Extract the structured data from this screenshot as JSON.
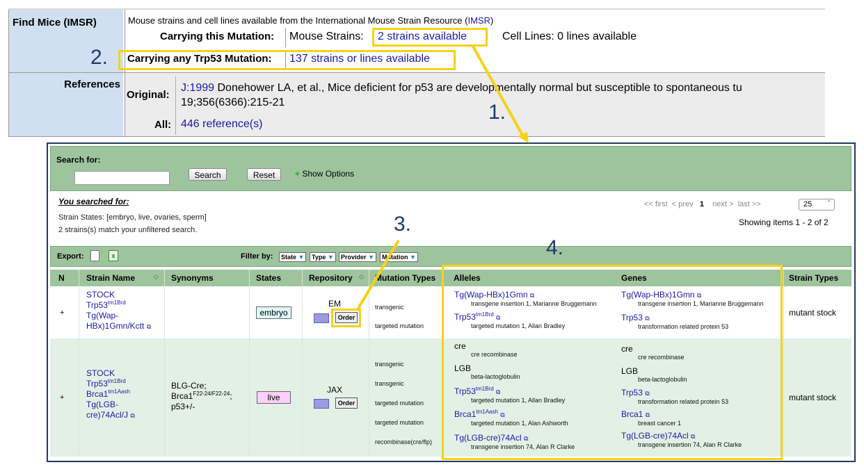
{
  "top": {
    "find_mice_label": "Find Mice (IMSR)",
    "imsr_text": "Mouse strains and cell lines available from the International Mouse Strain Resource (",
    "imsr_link": "IMSR",
    "imsr_close": ")",
    "carrying_this_label": "Carrying this Mutation:",
    "mouse_strains_label": "Mouse Strains:",
    "mouse_strains_link": "2 strains available",
    "cell_lines_text": "Cell Lines: 0 lines available",
    "carrying_any_label": "Carrying any Trp53 Mutation:",
    "carrying_any_link": "137 strains or lines available",
    "references_label": "References",
    "original_label": "Original:",
    "original_link": "J:1999",
    "original_text": "Donehower LA, et al., Mice deficient for p53 are developmentally normal but susceptible to spontaneous tu",
    "original_text2": "19;356(6366):215-21",
    "all_label": "All:",
    "all_link": "446 reference(s)"
  },
  "callouts": [
    "1.",
    "2.",
    "3.",
    "4."
  ],
  "search": {
    "search_for_label": "Search for:",
    "search_button": "Search",
    "reset_button": "Reset",
    "show_options": "Show Options",
    "you_searched": "You searched for:",
    "strain_states": "Strain States: [embryo, live, ovaries, sperm]",
    "match_text": "2 strains(s) match your unfiltered search.",
    "pager": {
      "first": "<< first",
      "prev": "< prev",
      "page": "1",
      "next": "next >",
      "last": "last >>"
    },
    "page_size": "25",
    "showing": "Showing items 1 - 2 of 2"
  },
  "export": {
    "export_label": "Export:",
    "filter_label": "Filter by:",
    "filters": [
      "State",
      "Type",
      "Provider",
      "Mutation"
    ]
  },
  "columns": [
    "N",
    "Strain Name",
    "Synonyms",
    "States",
    "Repository",
    "Mutation Types",
    "Alleles",
    "Genes",
    "Strain Types"
  ],
  "rows": [
    {
      "n": "+",
      "strain_1": "STOCK",
      "strain_2": "Trp53",
      "strain_2_sup": "tm1Brd",
      "strain_3": "Tg(Wap-",
      "strain_4": "HBx)1Gmn/Kctt",
      "synonyms": "",
      "state": "embryo",
      "repository": "EM",
      "order": "Order",
      "mut_types": [
        "transgenic",
        "targeted mutation"
      ],
      "alleles": [
        {
          "name": "Tg(Wap-HBx)1Gmn",
          "sup": "",
          "desc": "transgene insertion 1, Marianne Bruggemann"
        },
        {
          "name": "Trp53",
          "sup": "tm1Brd",
          "desc": "targeted mutation 1, Allan Bradley"
        }
      ],
      "genes": [
        {
          "name": "Tg(Wap-HBx)1Gmn",
          "desc": "transgene insertion 1, Marianne Bruggemann"
        },
        {
          "name": "Trp53",
          "desc": "transformation related protein 53"
        }
      ],
      "strain_type": "mutant stock"
    },
    {
      "n": "+",
      "strain_1": "STOCK",
      "strain_2": "Trp53",
      "strain_2_sup": "tm1Brd",
      "strain_3": "Brca1",
      "strain_3_sup": "tm1Aash",
      "strain_4": "Tg(LGB-",
      "strain_5": "cre)74Acl/J",
      "syn_1": "BLG-Cre;",
      "syn_2": "Brca1",
      "syn_2_sup": "F22-24/F22-24",
      "syn_2_tail": ";",
      "syn_3": "p53+/-",
      "state": "live",
      "repository": "JAX",
      "order": "Order",
      "mut_types": [
        "transgenic",
        "transgenic",
        "targeted mutation",
        "targeted mutation",
        "recombinase(cre/flp)"
      ],
      "alleles": [
        {
          "name": "cre",
          "sup": "",
          "desc": "cre recombinase"
        },
        {
          "name": "LGB",
          "sup": "",
          "desc": "beta-lactoglobulin"
        },
        {
          "name": "Trp53",
          "sup": "tm1Brd",
          "desc": "targeted mutation 1, Allan Bradley"
        },
        {
          "name": "Brca1",
          "sup": "tm1Aash",
          "desc": "targeted mutation 1, Alan Ashworth"
        },
        {
          "name": "Tg(LGB-cre)74Acl",
          "sup": "",
          "desc": "transgene insertion 74, Alan R Clarke"
        }
      ],
      "genes": [
        {
          "name": "cre",
          "desc": "cre recombinase"
        },
        {
          "name": "LGB",
          "desc": "beta-lactoglobulin"
        },
        {
          "name": "Trp53",
          "desc": "transformation related protein 53"
        },
        {
          "name": "Brca1",
          "desc": "breast cancer 1"
        },
        {
          "name": "Tg(LGB-cre)74Acl",
          "desc": "transgene insertion 74, Alan R Clarke"
        }
      ],
      "strain_type": "mutant stock"
    }
  ],
  "colors": {
    "accent_yellow": "#f7d117",
    "panel_green": "#9ec49e",
    "link_blue": "#1a1aa6",
    "callout_navy": "#1f3a6a"
  }
}
